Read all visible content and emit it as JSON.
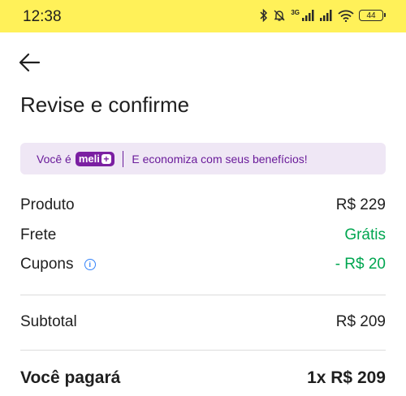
{
  "status_bar": {
    "time": "12:38",
    "network": "3G",
    "battery": "44",
    "icons": [
      "bluetooth-icon",
      "bell-muted-icon",
      "signal-icon",
      "signal-icon",
      "wifi-icon",
      "battery-icon"
    ]
  },
  "header": {
    "back_icon": "arrow-left-icon",
    "title": "Revise e confirme"
  },
  "banner": {
    "prefix": "Você é",
    "badge_text": "meli",
    "badge_plus": "+",
    "message": "E economiza com seus benefícios!"
  },
  "summary": {
    "rows": [
      {
        "label": "Produto",
        "value": "R$ 229"
      },
      {
        "label": "Frete",
        "value": "Grátis"
      },
      {
        "label": "Cupons",
        "value": "- R$ 20"
      }
    ],
    "subtotal": {
      "label": "Subtotal",
      "value": "R$ 209"
    },
    "total": {
      "label": "Você pagará",
      "value": "1x R$ 209"
    }
  },
  "colors": {
    "status_bar": "#fff159",
    "banner_bg": "#efe7f5",
    "brand_purple": "#7b1fa2",
    "green": "#00a650",
    "info_blue": "#3483fa"
  }
}
